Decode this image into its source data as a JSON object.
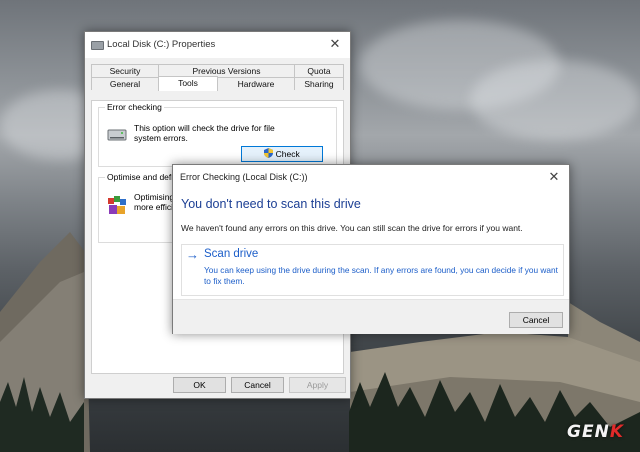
{
  "properties_window": {
    "title": "Local Disk (C:) Properties",
    "tabs_row1": [
      "Security",
      "Previous Versions",
      "Quota"
    ],
    "tabs_row2": [
      "General",
      "Tools",
      "Hardware",
      "Sharing"
    ],
    "active_tab": "Tools",
    "error_checking": {
      "legend": "Error checking",
      "description_line1": "This option will check the drive for file",
      "description_line2": "system errors.",
      "check_button": "Check"
    },
    "optimise": {
      "legend": "Optimise and defra",
      "line1": "Optimising",
      "line2": "more effici"
    },
    "buttons": {
      "ok": "OK",
      "cancel": "Cancel",
      "apply": "Apply"
    }
  },
  "error_dialog": {
    "title": "Error Checking (Local Disk (C:))",
    "heading": "You don't need to scan this drive",
    "info": "We haven't found any errors on this drive. You can still scan the drive for errors if you want.",
    "scan_link": {
      "arrow": "→",
      "title": "Scan drive",
      "description": "You can keep using the drive during the scan. If any errors are found, you can decide if you want to fix them."
    },
    "cancel_button": "Cancel"
  },
  "watermark": {
    "text1": "GEN",
    "text2": "K"
  },
  "colors": {
    "heading": "#1c3f94",
    "link": "#1c5ec9",
    "focus_border": "#0078d7"
  },
  "icons": [
    "drive-icon",
    "shield-icon",
    "defrag-icon",
    "close-icon",
    "arrow-right-icon"
  ]
}
